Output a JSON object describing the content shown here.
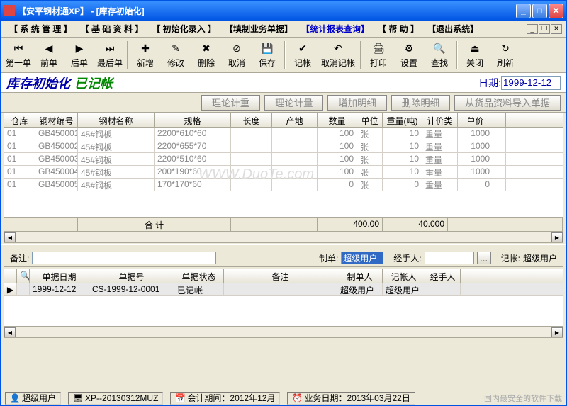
{
  "title": "【安平钢材通XP】 - [库存初始化]",
  "menu": [
    "【 系 统 管 理 】",
    "【 基 础 资 料 】",
    "【 初始化录入 】",
    "【填制业务单据】",
    "【统计报表查询】",
    "【 帮 助 】",
    "【退出系统】"
  ],
  "toolbar": [
    {
      "label": "第一单",
      "icon": "⏮"
    },
    {
      "label": "前单",
      "icon": "◀"
    },
    {
      "label": "后单",
      "icon": "▶"
    },
    {
      "label": "最后单",
      "icon": "⏭"
    },
    "sep",
    {
      "label": "新增",
      "icon": "✚"
    },
    {
      "label": "修改",
      "icon": "✎"
    },
    {
      "label": "删除",
      "icon": "✖"
    },
    {
      "label": "取消",
      "icon": "⊘"
    },
    {
      "label": "保存",
      "icon": "💾"
    },
    "sep",
    {
      "label": "记帐",
      "icon": "✔"
    },
    {
      "label": "取消记帐",
      "icon": "↶",
      "wide": true
    },
    "sep",
    {
      "label": "打印",
      "icon": "🖨"
    },
    {
      "label": "设置",
      "icon": "⚙"
    },
    {
      "label": "查找",
      "icon": "🔍"
    },
    "sep",
    {
      "label": "关闭",
      "icon": "⏏"
    },
    {
      "label": "刷新",
      "icon": "↻"
    }
  ],
  "header": {
    "title": "库存初始化",
    "status": "已记帐",
    "date_label": "日期:",
    "date_value": "1999-12-12"
  },
  "actions": [
    "理论计重",
    "理论计量",
    "增加明细",
    "删除明细",
    "从货品资料导入单据"
  ],
  "grid": {
    "cols": [
      "仓库名称",
      "钢材编号",
      "钢材名称",
      "规格",
      "长度",
      "产地",
      "数量",
      "单位",
      "重量(吨)",
      "计价类别",
      "单价"
    ],
    "rows": [
      {
        "wh": "01",
        "code": "GB450001",
        "name": "45#钢板",
        "spec": "2200*610*60",
        "len": "",
        "origin": "",
        "qty": "100",
        "unit": "张",
        "wt": "10",
        "cat": "重量",
        "price": "1000"
      },
      {
        "wh": "01",
        "code": "GB450002",
        "name": "45#钢板",
        "spec": "2200*655*70",
        "len": "",
        "origin": "",
        "qty": "100",
        "unit": "张",
        "wt": "10",
        "cat": "重量",
        "price": "1000"
      },
      {
        "wh": "01",
        "code": "GB450003",
        "name": "45#钢板",
        "spec": "2200*510*60",
        "len": "",
        "origin": "",
        "qty": "100",
        "unit": "张",
        "wt": "10",
        "cat": "重量",
        "price": "1000"
      },
      {
        "wh": "01",
        "code": "GB450004",
        "name": "45#钢板",
        "spec": "200*190*60",
        "len": "",
        "origin": "",
        "qty": "100",
        "unit": "张",
        "wt": "10",
        "cat": "重量",
        "price": "1000"
      },
      {
        "wh": "01",
        "code": "GB450005",
        "name": "45#钢板",
        "spec": "170*170*60",
        "len": "",
        "origin": "",
        "qty": "0",
        "unit": "张",
        "wt": "0",
        "cat": "重量",
        "price": "0"
      }
    ],
    "total_label": "合       计",
    "total_qty": "400.00",
    "total_wt": "40.000"
  },
  "form": {
    "memo_label": "备注:",
    "maker_label": "制单:",
    "maker_value": "超级用户",
    "handler_label": "经手人:",
    "booker_label": "记帐:",
    "booker_value": "超级用户"
  },
  "grid2": {
    "cols": [
      "单据日期",
      "单据号",
      "单据状态",
      "备注",
      "制单人",
      "记帐人",
      "经手人"
    ],
    "rows": [
      {
        "date": "1999-12-12",
        "no": "CS-1999-12-0001",
        "stat": "已记帐",
        "memo": "",
        "mk": "超级用户",
        "rk": "超级用户",
        "op": ""
      }
    ]
  },
  "status": {
    "user": "超级用户",
    "license": "XP--20130312MUZ",
    "period": "会计期间：2012年12月",
    "bizdate": "业务日期：2013年03月22日"
  },
  "footer_text": "国内最安全的软件下载"
}
